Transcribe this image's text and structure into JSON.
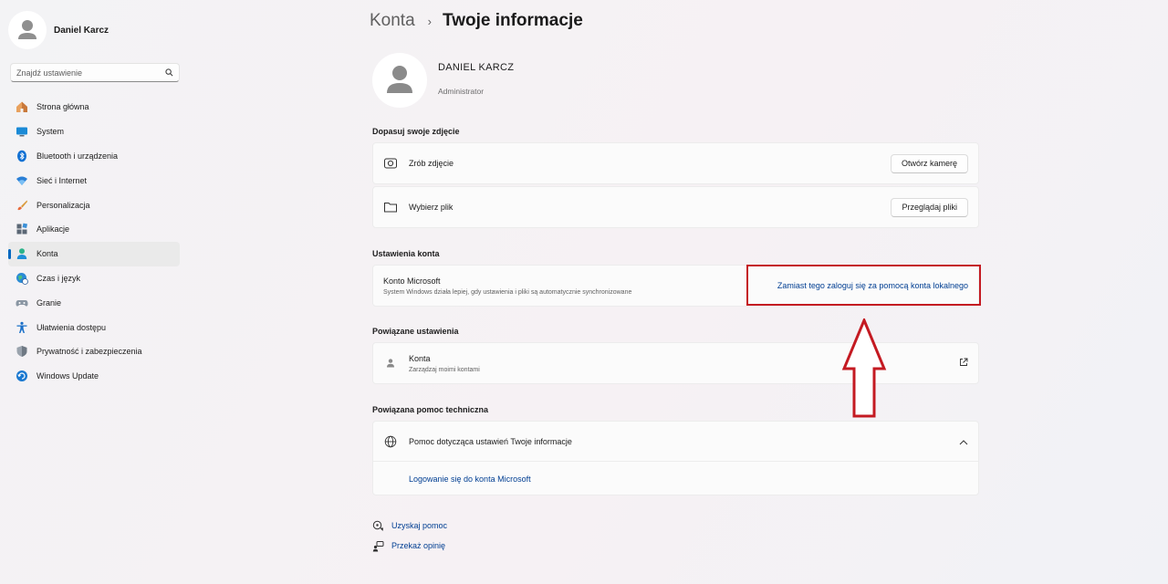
{
  "sidebar": {
    "user_name": "Daniel Karcz",
    "search_placeholder": "Znajdź ustawienie",
    "items": [
      {
        "label": "Strona główna",
        "icon": "home-icon"
      },
      {
        "label": "System",
        "icon": "monitor-icon"
      },
      {
        "label": "Bluetooth i urządzenia",
        "icon": "bluetooth-icon"
      },
      {
        "label": "Sieć i Internet",
        "icon": "wifi-icon"
      },
      {
        "label": "Personalizacja",
        "icon": "brush-icon"
      },
      {
        "label": "Aplikacje",
        "icon": "apps-icon"
      },
      {
        "label": "Konta",
        "icon": "person-icon"
      },
      {
        "label": "Czas i język",
        "icon": "globe-clock-icon"
      },
      {
        "label": "Granie",
        "icon": "gamepad-icon"
      },
      {
        "label": "Ułatwienia dostępu",
        "icon": "accessibility-icon"
      },
      {
        "label": "Prywatność i zabezpieczenia",
        "icon": "shield-icon"
      },
      {
        "label": "Windows Update",
        "icon": "update-icon"
      }
    ],
    "active_index": 6
  },
  "breadcrumb": {
    "parent": "Konta",
    "separator": "›",
    "current": "Twoje informacje"
  },
  "profile": {
    "name": "DANIEL KARCZ",
    "role": "Administrator"
  },
  "photo_section": {
    "title": "Dopasuj swoje zdjęcie",
    "take_photo_label": "Zrób zdjęcie",
    "open_camera_button": "Otwórz kamerę",
    "choose_file_label": "Wybierz plik",
    "browse_files_button": "Przeglądaj pliki"
  },
  "account_section": {
    "title": "Ustawienia konta",
    "ms_account_title": "Konto Microsoft",
    "ms_account_desc": "System Windows działa lepiej, gdy ustawienia i pliki są automatycznie synchronizowane",
    "local_account_link": "Zamiast tego zaloguj się za pomocą konta lokalnego"
  },
  "related_settings": {
    "title": "Powiązane ustawienia",
    "accounts_title": "Konta",
    "accounts_desc": "Zarządzaj moimi kontami"
  },
  "related_help": {
    "title": "Powiązana pomoc techniczna",
    "help_item": "Pomoc dotycząca ustawień Twoje informacje",
    "help_link": "Logowanie się do konta Microsoft"
  },
  "footer": {
    "get_help": "Uzyskaj pomoc",
    "feedback": "Przekaż opinię"
  },
  "colors": {
    "accent": "#0067c0",
    "link": "#003e92",
    "annotation_red": "#c41a22"
  }
}
